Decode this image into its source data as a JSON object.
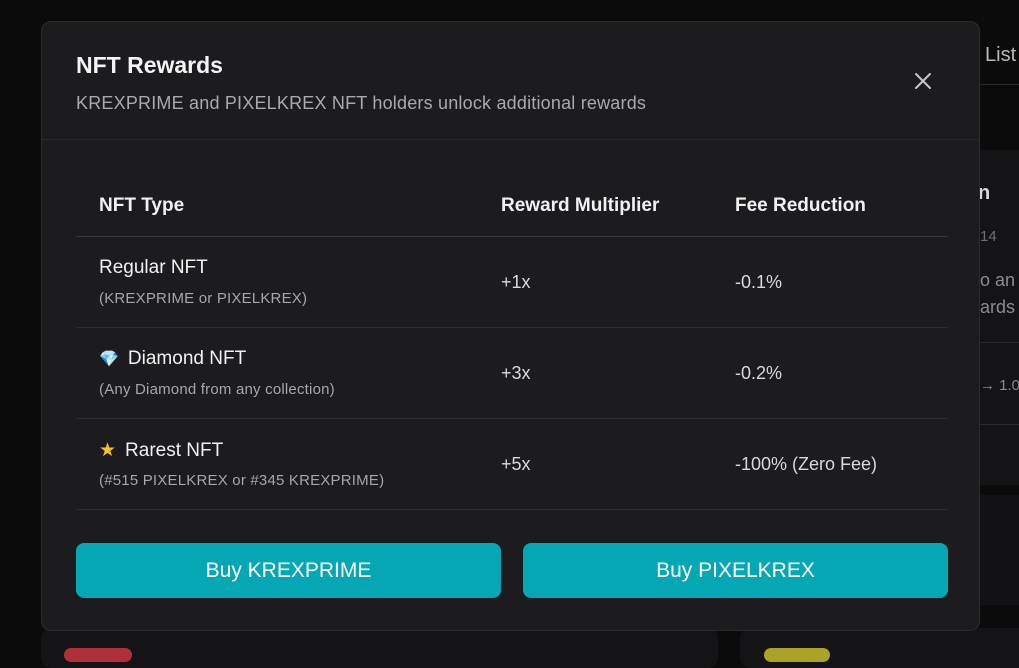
{
  "background": {
    "tab_partial": "List",
    "heading_partial": "n",
    "date_partial": "14",
    "line1_partial": "o an",
    "line2_partial": "ards",
    "value_partial": "→ 1.0"
  },
  "modal": {
    "title": "NFT Rewards",
    "subtitle": "KREXPRIME and PIXELKREX NFT holders unlock additional rewards",
    "close_icon": "close-icon"
  },
  "table": {
    "headers": [
      "NFT Type",
      "Reward Multiplier",
      "Fee Reduction"
    ],
    "rows": [
      {
        "icon": "",
        "name": "Regular NFT",
        "desc": "(KREXPRIME or PIXELKREX)",
        "multiplier": "+1x",
        "fee": "-0.1%"
      },
      {
        "icon": "💎",
        "name": "Diamond NFT",
        "desc": "(Any Diamond from any collection)",
        "multiplier": "+3x",
        "fee": "-0.2%"
      },
      {
        "icon": "★",
        "name": "Rarest NFT",
        "desc": "(#515 PIXELKREX or #345 KREXPRIME)",
        "multiplier": "+5x",
        "fee": "-100% (Zero Fee)"
      }
    ]
  },
  "buttons": {
    "buy_krexprime": "Buy KREXPRIME",
    "buy_pixelkrex": "Buy PIXELKREX"
  },
  "colors": {
    "accent": "#04a7b3",
    "modal_bg": "#1c1c1e",
    "page_bg": "#0b0b0c"
  }
}
